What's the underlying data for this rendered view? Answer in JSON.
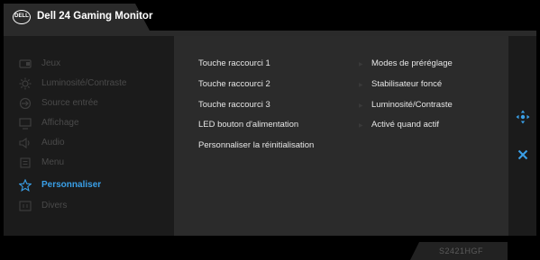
{
  "header": {
    "logo_text": "DELL",
    "title": "Dell 24 Gaming Monitor"
  },
  "sidebar": {
    "items": [
      {
        "label": "Jeux",
        "icon": "gamepad-icon"
      },
      {
        "label": "Luminosité/Contraste",
        "icon": "brightness-icon"
      },
      {
        "label": "Source entrée",
        "icon": "input-source-icon"
      },
      {
        "label": "Affichage",
        "icon": "monitor-icon"
      },
      {
        "label": "Audio",
        "icon": "speaker-icon"
      },
      {
        "label": "Menu",
        "icon": "menu-icon"
      },
      {
        "label": "Personnaliser",
        "icon": "star-icon",
        "active": true
      },
      {
        "label": "Divers",
        "icon": "info-icon"
      }
    ]
  },
  "content": {
    "rows": [
      {
        "label": "Touche raccourci 1",
        "value": "Modes de préréglage"
      },
      {
        "label": "Touche raccourci 2",
        "value": "Stabilisateur foncé"
      },
      {
        "label": "Touche raccourci 3",
        "value": "Luminosité/Contraste"
      },
      {
        "label": "LED bouton d'alimentation",
        "value": "Activé quand actif"
      },
      {
        "label": "Personnaliser la réinitialisation",
        "value": ""
      }
    ]
  },
  "controls": {
    "navigate_icon": "navigate-icon",
    "close_icon": "close-icon"
  },
  "footer": {
    "model": "S2421HGF"
  },
  "colors": {
    "accent": "#3aa0e8",
    "panel": "#2b2b2b",
    "sidebar": "#1b1b1b"
  }
}
